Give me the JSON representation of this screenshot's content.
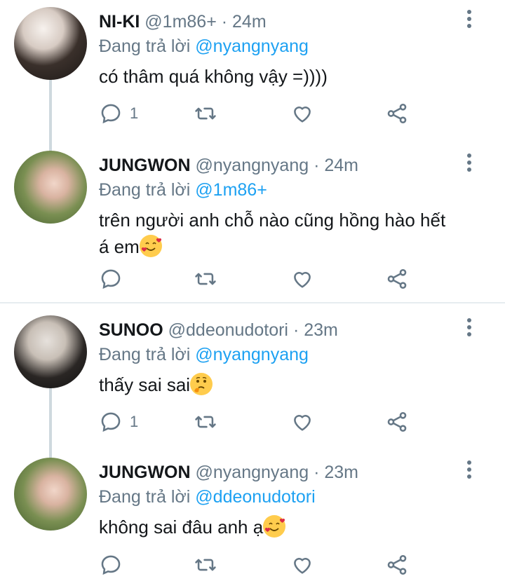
{
  "tweets": [
    {
      "name": "NI-KI",
      "handle": "@1m86+",
      "time": "· 24m",
      "reply_prefix": "Đang trả lời",
      "reply_to": "@nyangnyang",
      "text": "có thâm quá không vậy =))))",
      "reply_count": "1"
    },
    {
      "name": "JUNGWON",
      "handle": "@nyangnyang",
      "time": "· 24m",
      "reply_prefix": "Đang trả lời",
      "reply_to": "@1m86+",
      "text_line1": "trên người anh chỗ nào cũng hồng hào hết",
      "text_line2": "á em",
      "emoji": "smiling-face-with-hearts",
      "reply_count": ""
    },
    {
      "name": "SUNOO",
      "handle": "@ddeonudotori",
      "time": "· 23m",
      "reply_prefix": "Đang trả lời",
      "reply_to": "@nyangnyang",
      "text": "thấy sai sai",
      "emoji": "thinking-face",
      "reply_count": "1"
    },
    {
      "name": "JUNGWON",
      "handle": "@nyangnyang",
      "time": "· 23m",
      "reply_prefix": "Đang trả lời",
      "reply_to": "@ddeonudotori",
      "text": "không sai đâu anh ạ",
      "emoji": "smiling-face-with-hearts",
      "reply_count": ""
    }
  ],
  "colors": {
    "mention": "#1da1f2",
    "secondary": "#657786",
    "thread_line": "#cfd9de"
  }
}
